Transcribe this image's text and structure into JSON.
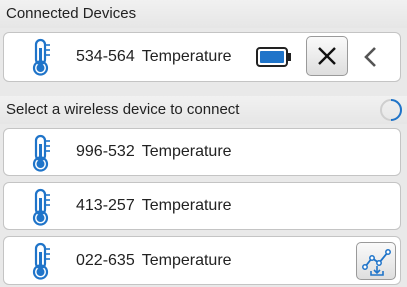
{
  "connected": {
    "title": "Connected Devices",
    "device": {
      "id": "534-564",
      "type": "Temperature"
    }
  },
  "available": {
    "title": "Select a wireless device to connect",
    "devices": [
      {
        "id": "996-532",
        "type": "Temperature"
      },
      {
        "id": "413-257",
        "type": "Temperature"
      },
      {
        "id": "022-635",
        "type": "Temperature"
      }
    ]
  },
  "icons": {
    "thermometer": "thermometer-icon",
    "battery": "battery-icon",
    "close": "close-icon",
    "collapse": "chevron-left-icon",
    "scanning": "spinner-icon",
    "export": "graph-download-icon"
  },
  "colors": {
    "accent": "#1f74c9",
    "battery_fill": "#1f74c9"
  }
}
